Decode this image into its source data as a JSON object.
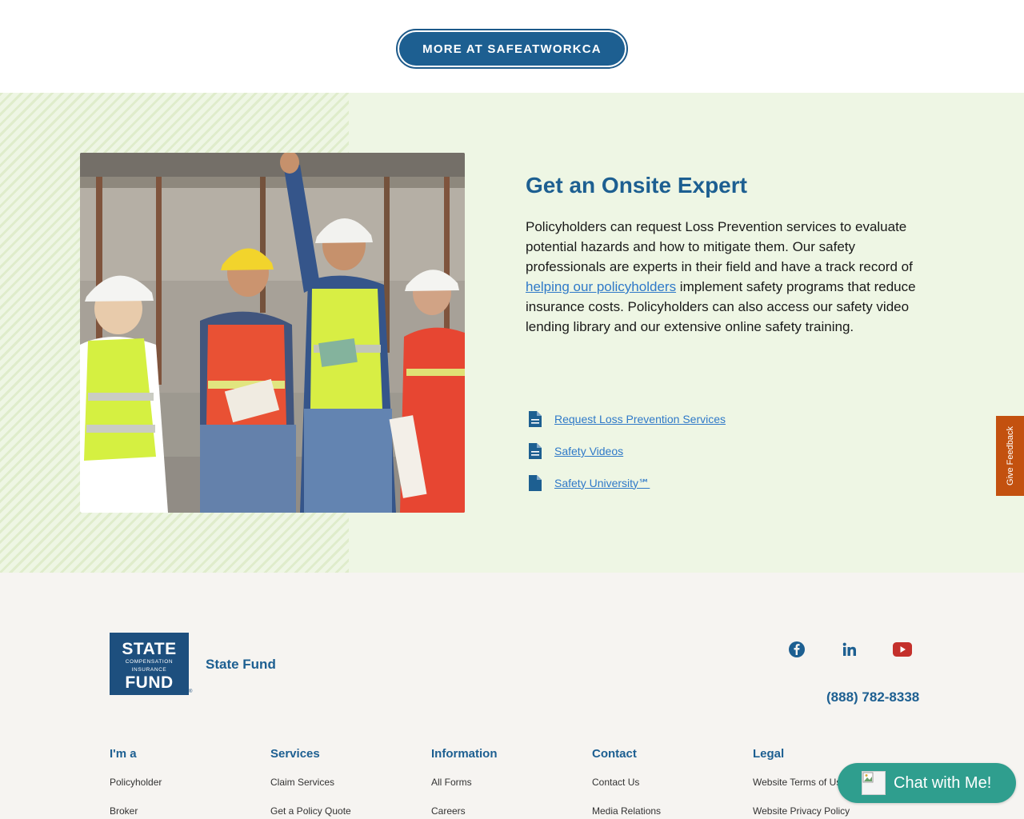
{
  "top_button": {
    "label": "MORE AT SAFEATWORKCA"
  },
  "onsite": {
    "title": "Get an Onsite Expert",
    "body_before_link": "Policyholders can request Loss Prevention services to evaluate potential hazards and how to mitigate them. Our safety professionals are experts in their field and have a track record of ",
    "link_text": "helping our policyholders",
    "body_after_link": " implement safety programs that reduce insurance costs. Policyholders can also access our safety video lending library and our extensive online safety training.",
    "doc_links": [
      {
        "label": "Request Loss Prevention Services",
        "icon": "document-icon"
      },
      {
        "label": "Safety Videos",
        "icon": "document-icon"
      },
      {
        "label": "Safety University℠",
        "icon": "document-icon"
      }
    ]
  },
  "feedback": {
    "label": "Give Feedback"
  },
  "footer": {
    "logo": {
      "line1": "STATE",
      "line2a": "COMPENSATION",
      "line2b": "INSURANCE",
      "line3": "FUND",
      "reg": "®"
    },
    "brand_name": "State Fund",
    "social": [
      {
        "icon": "facebook-icon",
        "color": "#1d5f91"
      },
      {
        "icon": "linkedin-icon",
        "color": "#1d5f91"
      },
      {
        "icon": "youtube-icon",
        "color": "#c4302b"
      }
    ],
    "phone": "(888) 782-8338",
    "columns": [
      {
        "heading": "I'm a",
        "items": [
          "Policyholder",
          "Broker"
        ]
      },
      {
        "heading": "Services",
        "items": [
          "Claim Services",
          "Get a Policy Quote"
        ]
      },
      {
        "heading": "Information",
        "items": [
          "All Forms",
          "Careers"
        ]
      },
      {
        "heading": "Contact",
        "items": [
          "Contact Us",
          "Media Relations"
        ]
      },
      {
        "heading": "Legal",
        "items": [
          "Website Terms of Use",
          "Website Privacy Policy"
        ]
      }
    ]
  },
  "chat": {
    "label": "Chat with Me!"
  },
  "colors": {
    "primary_blue": "#1d5f91",
    "link_blue": "#2f79c8",
    "green_bg": "#eef6e4",
    "feedback_orange": "#c3510f",
    "chat_teal": "#2f9e8e"
  }
}
